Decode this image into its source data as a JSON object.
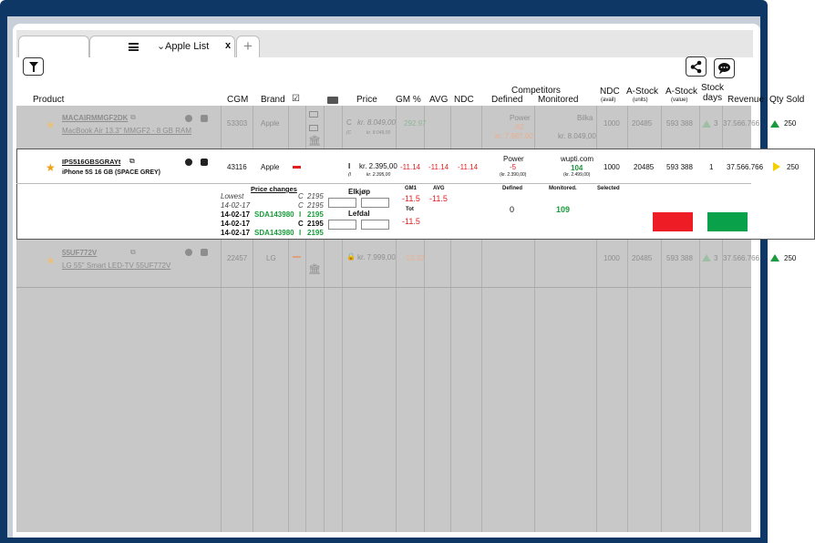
{
  "tabs": {
    "list_label": "Apple List",
    "close_label": "x",
    "add_label": "+"
  },
  "columns": {
    "product": "Product",
    "cgm": "CGM",
    "brand": "Brand",
    "price": "Price",
    "gm_pct": "GM %",
    "avg": "AVG",
    "ndc": "NDC",
    "competitors": "Competitors",
    "defined": "Defined",
    "monitored": "Monitored",
    "ndc_avail": "NDC",
    "ndc_avail_sub": "(avail)",
    "astock_units": "A-Stock",
    "astock_units_sub": "(units)",
    "astock_value": "A-Stock",
    "astock_value_sub": "(value)",
    "stock_days_1": "Stock",
    "stock_days_2": "days",
    "revenue": "Revenue",
    "qty_sold": "Qty Sold"
  },
  "rows": {
    "r1": {
      "sku": "MACAIRMMGF2DK",
      "name": "MacBook Air 13.3\" MMGF2 - 8 GB RAM",
      "cgm": "53303",
      "brand": "Apple",
      "price_code": "C",
      "price_code2": "(C",
      "price": "kr. 8.049,00",
      "price_small": "kr. 8.049,00",
      "gm": "292.97",
      "comp_defined_name": "Power",
      "comp_defined_val": "-62",
      "comp_defined_price": "kr. 7.987,00",
      "comp_monitored_name": "Bilka",
      "comp_monitored_price": "kr. 8.049,00",
      "ndc": "1000",
      "astock_units": "20485",
      "astock_value": "593 388",
      "stock_days": "3",
      "revenue": "37.566.766",
      "qty": "250"
    },
    "r2": {
      "sku": "IPS516GBSGRAYt",
      "name": "iPhone 5S 16 GB (SPACE GREY)",
      "cgm": "43116",
      "brand": "Apple",
      "price_code": "I",
      "price_code2": "(I",
      "price": "kr. 2.395,00",
      "price_small": "kr. 2.395,00",
      "gm": "-11.14",
      "avg": "-11.14",
      "ndc_val": "-11.14",
      "comp_defined_name": "Power",
      "comp_defined_val": "-5",
      "comp_defined_price": "(kr. 2.390,00)",
      "comp_monitored_name": "wupti.com",
      "comp_monitored_val": "104",
      "comp_monitored_price": "(kr. 2.499,00)",
      "ndc": "1000",
      "astock_units": "20485",
      "astock_value": "593 388",
      "stock_days": "1",
      "revenue": "37.566.766",
      "qty": "250"
    },
    "r3": {
      "sku": "55UF772V",
      "name": "LG 55\" Smart LED-TV 55UF772V",
      "cgm": "22457",
      "brand": "LG",
      "price": "kr. 7.999,00",
      "gm": "-10.32",
      "ndc": "1000",
      "astock_units": "20485",
      "astock_value": "593 388",
      "stock_days": "3",
      "revenue": "37.566.766",
      "qty": "250"
    }
  },
  "detail": {
    "price_changes_title": "Price changes",
    "history": [
      {
        "date": "Lowest",
        "note": "",
        "code": "C",
        "price": "2195"
      },
      {
        "date": "14-02-17",
        "note": "",
        "code": "C",
        "price": "2195"
      },
      {
        "date": "14-02-17",
        "note": "SDA143980",
        "code": "I",
        "price": "2195"
      },
      {
        "date": "14-02-17",
        "note": "",
        "code": "C",
        "price": "2195"
      },
      {
        "date": "14-02-17",
        "note": "SDA143980",
        "code": "I",
        "price": "2195"
      }
    ],
    "store1": "Elkjøp",
    "store2": "Lefdal",
    "gm1_label": "GM1",
    "gm1_value": "-11.5",
    "tot_label": "Tot",
    "tot_value": "-11.5",
    "avg_label": "AVG",
    "avg_value": "-11.5",
    "defined_label": "Defined",
    "defined_value": "0",
    "monitored_label": "Monitored.",
    "monitored_value": "109",
    "selected_label": "Selected"
  },
  "colors": {
    "frame": "#0f3766",
    "red_button": "#ee1c25",
    "green_button": "#0aa14b",
    "negative": "#e02020",
    "positive": "#1a9b3c"
  }
}
